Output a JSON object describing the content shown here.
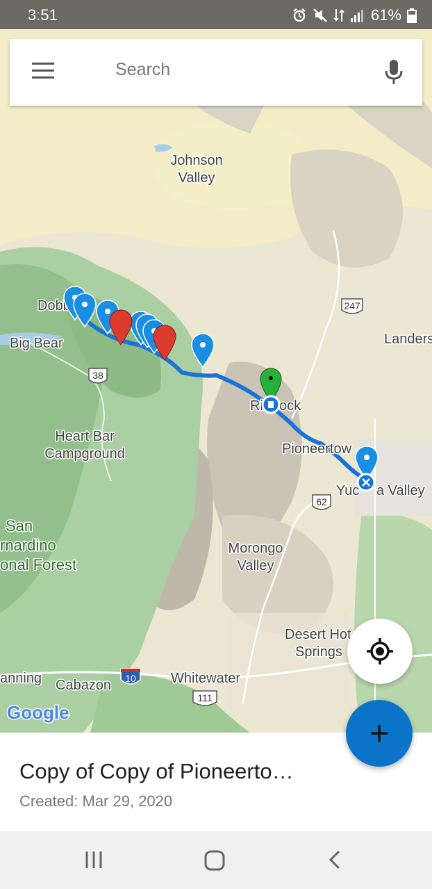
{
  "status_bar": {
    "time": "3:51",
    "battery": "61%"
  },
  "search": {
    "placeholder": "Search"
  },
  "map": {
    "labels": {
      "johnson_valley_1": "Johnson",
      "johnson_valley_2": "Valley",
      "dobbs": "Dobb",
      "big_bear": "Big Bear",
      "landers": "Landers",
      "rimrock_left": "Ri",
      "rimrock_right": "ock",
      "pioneertown": "Pioneertow",
      "yucca_left": "Yuc",
      "yucca_right": "a Valley",
      "heart_bar_1": "Heart Bar",
      "heart_bar_2": "Campground",
      "san_bernardino_1": "San",
      "san_bernardino_2": "rnardino",
      "san_bernardino_3": "onal Forest",
      "morongo_1": "Morongo",
      "morongo_2": "Valley",
      "desert_hot_1": "Desert Hot",
      "desert_hot_2": "Springs",
      "banning": "anning",
      "cabazon": "Cabazon",
      "whitewater": "Whitewater"
    },
    "route_shields": {
      "r247": "247",
      "r38": "38",
      "r62": "62",
      "i10": "10",
      "r111": "111"
    },
    "logo": "Google",
    "colors": {
      "route": "#1a73d6",
      "pin_blue": "#1a8ee3",
      "pin_red": "#d93b2f",
      "pin_green": "#27b03a"
    }
  },
  "route": {
    "title": "Copy of Copy of Pioneerto…",
    "created": "Created: Mar 29, 2020"
  }
}
